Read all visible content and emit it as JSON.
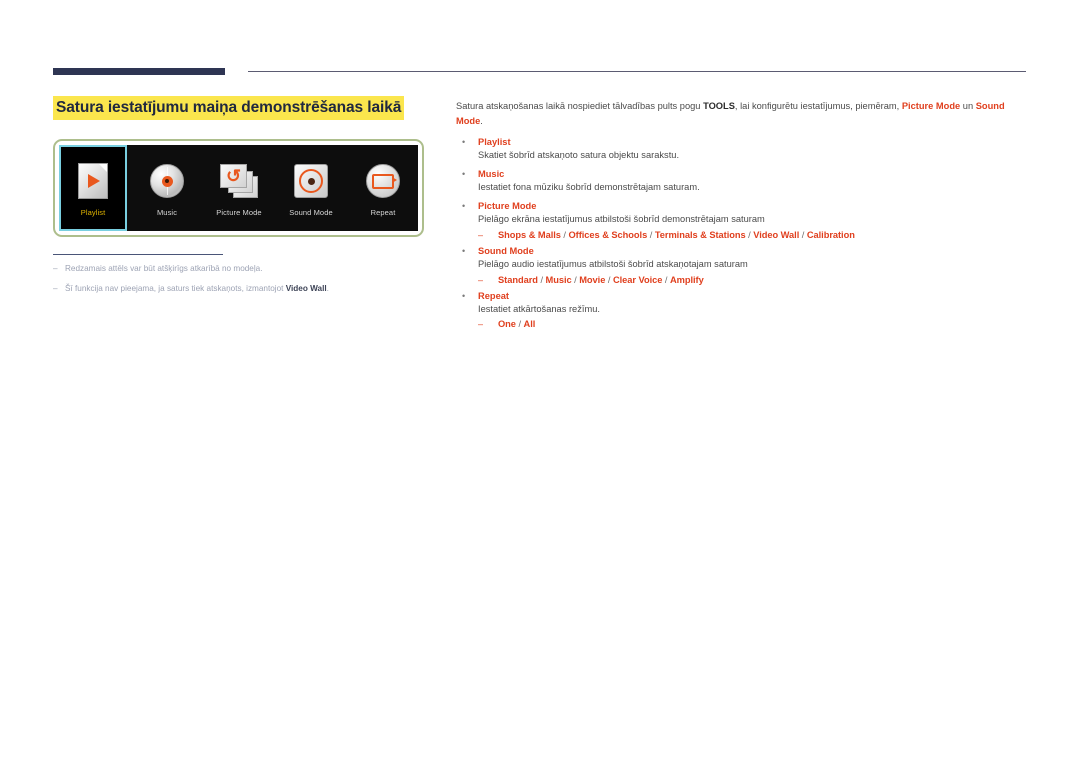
{
  "page": {
    "title": "Satura iestatījumu maiņa demonstrēšanas laikā"
  },
  "device_preview": {
    "tiles": [
      {
        "label": "Playlist",
        "icon": "playlist-document-play-icon",
        "selected": true
      },
      {
        "label": "Music",
        "icon": "music-disc-icon",
        "selected": false
      },
      {
        "label": "Picture Mode",
        "icon": "picture-mode-sheets-cycle-icon",
        "selected": false
      },
      {
        "label": "Sound Mode",
        "icon": "sound-mode-speaker-icon",
        "selected": false
      },
      {
        "label": "Repeat",
        "icon": "repeat-loop-icon",
        "selected": false
      }
    ]
  },
  "footnotes": [
    {
      "dash": "–",
      "text": "Redzamais attēls var būt atšķirīgs atkarībā no modeļa.",
      "bold": ""
    },
    {
      "dash": "–",
      "text_before": "Šī funkcija nav pieejama, ja saturs tiek atskaņots, izmantojot ",
      "bold": "Video Wall",
      "text_after": "."
    }
  ],
  "content": {
    "intro": {
      "part1": "Satura atskaņošanas laikā nospiediet tālvadības pults pogu ",
      "tools": "TOOLS",
      "part2": ", lai konfigurētu iestatījumus, piemēram, ",
      "accent1": "Picture Mode",
      "part3": " un ",
      "accent2": "Sound Mode",
      "part4": "."
    },
    "bullet_marker": "•",
    "dash_marker": "–",
    "items": [
      {
        "title": "Playlist",
        "desc": "Skatiet šobrīd atskaņoto satura objektu sarakstu.",
        "options": []
      },
      {
        "title": "Music",
        "desc": "Iestatiet fona mūziku šobrīd demonstrētajam saturam.",
        "options": []
      },
      {
        "title": "Picture Mode",
        "desc": "Pielāgo ekrāna iestatījumus atbilstoši šobrīd demonstrētajam saturam",
        "options": [
          "Shops & Malls",
          "Offices & Schools",
          "Terminals & Stations",
          "Video Wall",
          "Calibration"
        ]
      },
      {
        "title": "Sound Mode",
        "desc": "Pielāgo audio iestatījumus atbilstoši šobrīd atskaņotajam saturam",
        "options": [
          "Standard",
          "Music",
          "Movie",
          "Clear Voice",
          "Amplify"
        ]
      },
      {
        "title": "Repeat",
        "desc": "Iestatiet atkārtošanas režīmu.",
        "options": [
          "One",
          "All"
        ]
      }
    ]
  },
  "colors": {
    "accent_red": "#e0401f",
    "title_navy": "#20283f",
    "highlight_yellow": "#fbe64d",
    "frame_green": "#adbe8c",
    "selected_cyan": "#79cfe0",
    "selected_label_gold": "#e0b400",
    "icon_orange": "#e9581e",
    "footnote_gray": "#9da3b4"
  }
}
